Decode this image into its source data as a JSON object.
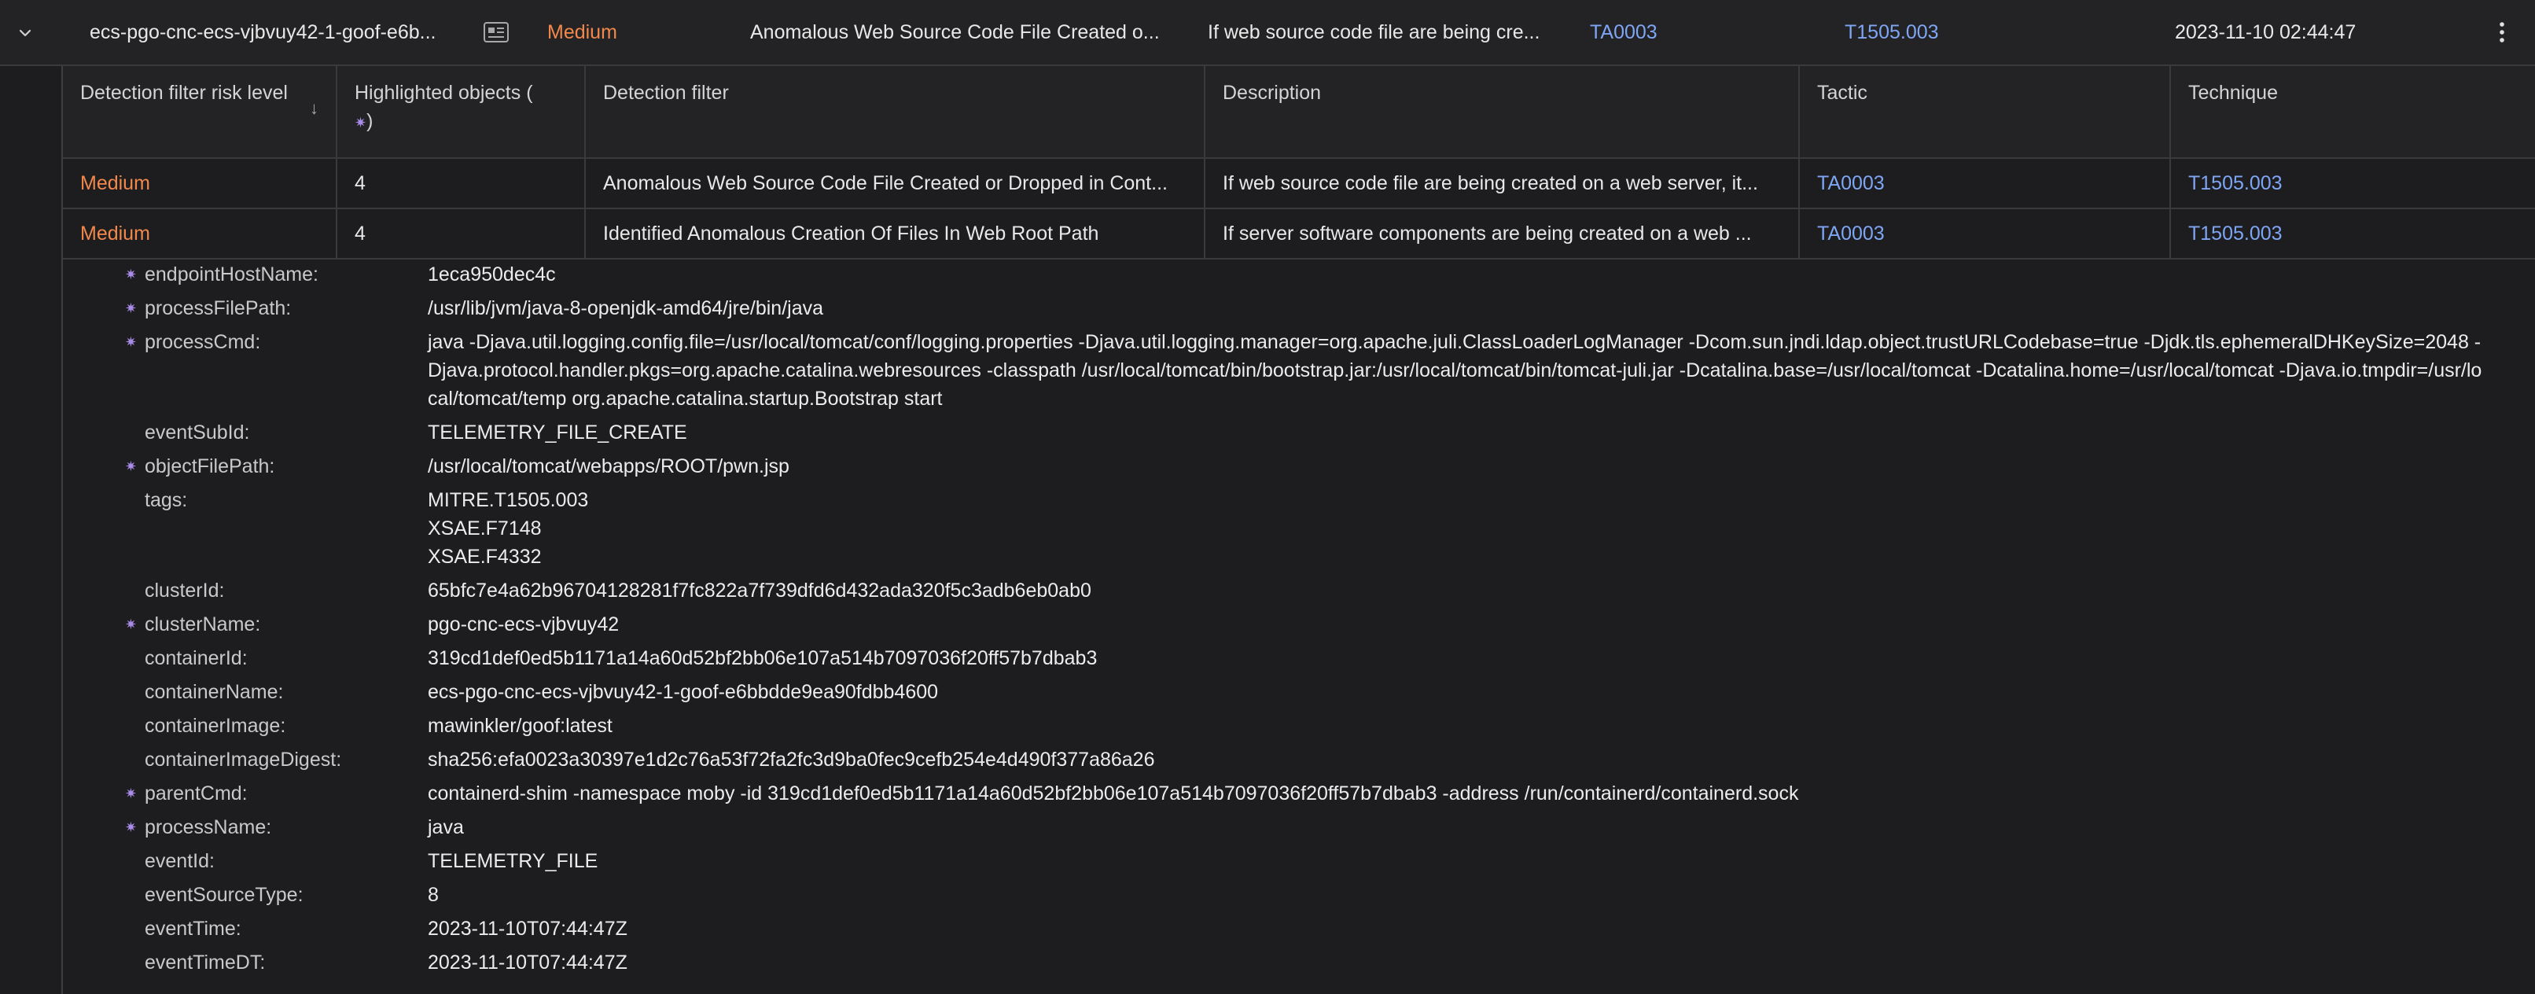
{
  "topbar": {
    "host": "ecs-pgo-cnc-ecs-vjbvuy42-1-goof-e6b...",
    "risk": "Medium",
    "filter": "Anomalous Web Source Code File Created o...",
    "description": "If web source code file are being cre...",
    "tactic": "TA0003",
    "technique": "T1505.003",
    "time": "2023-11-10 02:44:47",
    "icons": {
      "expand": "chevron-down-icon",
      "card": "card-details-icon",
      "menu": "kebab-menu-icon"
    }
  },
  "table": {
    "headers": {
      "risk": "Detection filter risk level",
      "highlighted": "Highlighted objects (",
      "highlighted_end": ")",
      "filter": "Detection filter",
      "description": "Description",
      "tactic": "Tactic",
      "technique": "Technique"
    },
    "rows": [
      {
        "risk": "Medium",
        "highlighted": "4",
        "filter": "Anomalous Web Source Code File Created or Dropped in Cont...",
        "description": "If web source code file are being created on a web server, it...",
        "tactic": "TA0003",
        "technique": "T1505.003"
      },
      {
        "risk": "Medium",
        "highlighted": "4",
        "filter": "Identified Anomalous Creation Of Files In Web Root Path",
        "description": "If server software components are being created on a web ...",
        "tactic": "TA0003",
        "technique": "T1505.003"
      }
    ]
  },
  "details": [
    {
      "key": "endpointHostName:",
      "value": "1eca950dec4c",
      "highlighted": true
    },
    {
      "key": "processFilePath:",
      "value": "/usr/lib/jvm/java-8-openjdk-amd64/jre/bin/java",
      "highlighted": true
    },
    {
      "key": "processCmd:",
      "value": "java -Djava.util.logging.config.file=/usr/local/tomcat/conf/logging.properties -Djava.util.logging.manager=org.apache.juli.ClassLoaderLogManager -Dcom.sun.jndi.ldap.object.trustURLCodebase=true -Djdk.tls.ephemeralDHKeySize=2048 -Djava.protocol.handler.pkgs=org.apache.catalina.webresources -classpath /usr/local/tomcat/bin/bootstrap.jar:/usr/local/tomcat/bin/tomcat-juli.jar -Dcatalina.base=/usr/local/tomcat -Dcatalina.home=/usr/local/tomcat -Djava.io.tmpdir=/usr/local/tomcat/temp org.apache.catalina.startup.Bootstrap start",
      "highlighted": true
    },
    {
      "key": "eventSubId:",
      "value": "TELEMETRY_FILE_CREATE",
      "highlighted": false
    },
    {
      "key": "objectFilePath:",
      "value": "/usr/local/tomcat/webapps/ROOT/pwn.jsp",
      "highlighted": true
    },
    {
      "key": "tags:",
      "value": "MITRE.T1505.003\nXSAE.F7148\nXSAE.F4332",
      "highlighted": false
    },
    {
      "key": "clusterId:",
      "value": "65bfc7e4a62b96704128281f7fc822a7f739dfd6d432ada320f5c3adb6eb0ab0",
      "highlighted": false
    },
    {
      "key": "clusterName:",
      "value": "pgo-cnc-ecs-vjbvuy42",
      "highlighted": true
    },
    {
      "key": "containerId:",
      "value": "319cd1def0ed5b1171a14a60d52bf2bb06e107a514b7097036f20ff57b7dbab3",
      "highlighted": false
    },
    {
      "key": "containerName:",
      "value": "ecs-pgo-cnc-ecs-vjbvuy42-1-goof-e6bbdde9ea90fdbb4600",
      "highlighted": false
    },
    {
      "key": "containerImage:",
      "value": "mawinkler/goof:latest",
      "highlighted": false
    },
    {
      "key": "containerImageDigest:",
      "value": "sha256:efa0023a30397e1d2c76a53f72fa2fc3d9ba0fec9cefb254e4d490f377a86a26",
      "highlighted": false
    },
    {
      "key": "parentCmd:",
      "value": "containerd-shim -namespace moby -id 319cd1def0ed5b1171a14a60d52bf2bb06e107a514b7097036f20ff57b7dbab3 -address /run/containerd/containerd.sock",
      "highlighted": true
    },
    {
      "key": "processName:",
      "value": "java",
      "highlighted": true
    },
    {
      "key": "eventId:",
      "value": "TELEMETRY_FILE",
      "highlighted": false
    },
    {
      "key": "eventSourceType:",
      "value": "8",
      "highlighted": false
    },
    {
      "key": "eventTime:",
      "value": "2023-11-10T07:44:47Z",
      "highlighted": false
    },
    {
      "key": "eventTimeDT:",
      "value": "2023-11-10T07:44:47Z",
      "highlighted": false
    }
  ],
  "colors": {
    "accent_orange": "#f2884b",
    "link_blue": "#7fa6f4",
    "highlight_purple": "#a98be8"
  }
}
